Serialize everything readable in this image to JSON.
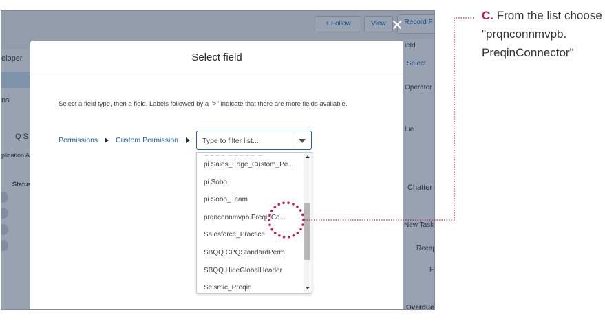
{
  "background": {
    "follow_button": "+ Follow",
    "view_button": "View",
    "record_button": "Record F",
    "left_labels": [
      "eloper",
      "ns",
      "plication A",
      "Status"
    ],
    "search_glyph": "Q S",
    "right_labels": [
      "ield",
      "Select",
      "Operator",
      "lue",
      "Chatter",
      "New Task",
      "Recap",
      "Fi",
      "Overdue"
    ]
  },
  "modal": {
    "title": "Select field",
    "close_glyph": "✕",
    "help_text": "Select a field type, then a field. Labels followed by a \">\" indicate that there are more fields available.",
    "breadcrumbs": [
      "Permissions",
      "Custom Permission"
    ],
    "filter": {
      "placeholder": "Type to filter list...",
      "value": ""
    },
    "list_items": [
      "pi.Sales_Edge_Custom_Pe...",
      "pi.Sobo",
      "pi.Sobo_Team",
      "prqnconnmvpb.PreqinCo...",
      "Salesforce_Practice",
      "SBQQ.CPQStandardPerm",
      "SBQQ.HideGlobalHeader",
      "Seismic_Preqin"
    ]
  },
  "annotation": {
    "letter": "C.",
    "text": "From the list choose \"prqnconnmvpb. PreqinConnector\"",
    "color": "#c2185b"
  }
}
